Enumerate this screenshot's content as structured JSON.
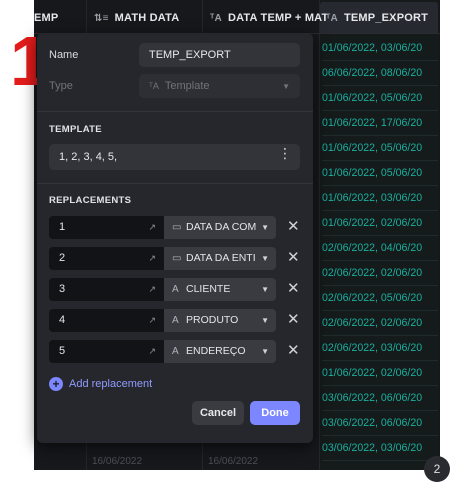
{
  "columns": {
    "col1": {
      "label": "EMP"
    },
    "col2": {
      "label": "MATH DATA"
    },
    "col3": {
      "label": "DATA TEMP + MAT"
    },
    "col4": {
      "label": "TEMP_EXPORT"
    }
  },
  "temp_export_cells": [
    "01/06/2022, 03/06/20",
    "06/06/2022, 08/06/20",
    "01/06/2022, 05/06/20",
    "01/06/2022, 17/06/20",
    "01/06/2022, 05/06/20",
    "01/06/2022, 05/06/20",
    "01/06/2022, 03/06/20",
    "01/06/2022, 02/06/20",
    "02/06/2022, 04/06/20",
    "02/06/2022, 02/06/20",
    "02/06/2022, 05/06/20",
    "02/06/2022, 02/06/20",
    "02/06/2022, 03/06/20",
    "01/06/2022, 02/06/20",
    "03/06/2022, 06/06/20",
    "03/06/2022, 06/06/20",
    "03/06/2022, 03/06/20"
  ],
  "bottom_row": {
    "a": "16/06/2022",
    "b": "16/06/2022"
  },
  "annotation_number": "1",
  "dialog": {
    "name_label": "Name",
    "name_value": "TEMP_EXPORT",
    "type_label": "Type",
    "type_value": "Template",
    "template_section": "TEMPLATE",
    "template_value": "1, 2, 3, 4, 5,",
    "replacements_section": "REPLACEMENTS",
    "replacements": [
      {
        "key": "1",
        "field": "DATA DA COM",
        "icon": "calendar-icon"
      },
      {
        "key": "2",
        "field": "DATA DA ENTI",
        "icon": "calendar-icon"
      },
      {
        "key": "3",
        "field": "CLIENTE",
        "icon": "text-icon"
      },
      {
        "key": "4",
        "field": "PRODUTO",
        "icon": "text-icon"
      },
      {
        "key": "5",
        "field": "ENDEREÇO",
        "icon": "text-icon"
      }
    ],
    "add_replacement": "Add replacement",
    "cancel": "Cancel",
    "done": "Done"
  },
  "corner_badge": "2",
  "colors": {
    "accent": "#7b86ff",
    "teal": "#1bb0a0",
    "annotation": "#e31b1b"
  }
}
